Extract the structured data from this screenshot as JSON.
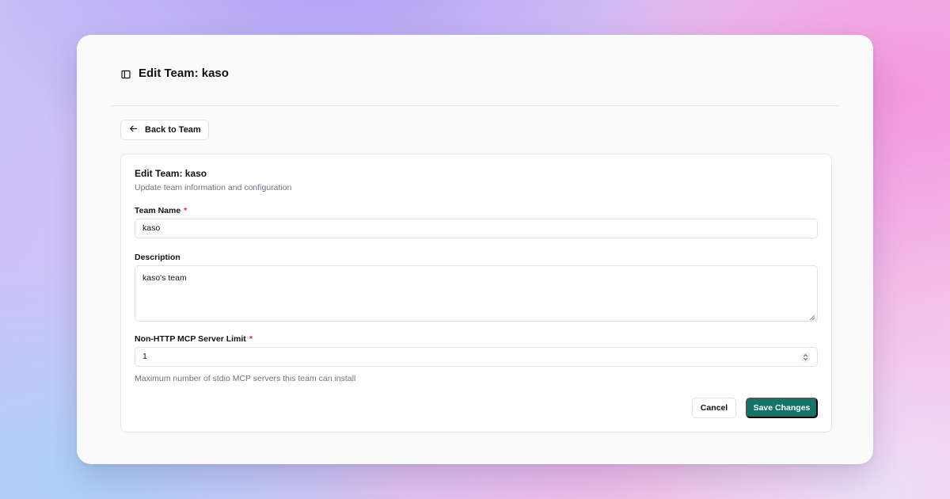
{
  "header": {
    "title": "Edit Team: kaso",
    "toggle_icon": "sidebar-toggle-icon"
  },
  "back_button": {
    "label": "Back to Team",
    "icon": "arrow-left-icon"
  },
  "card": {
    "title": "Edit Team: kaso",
    "subtitle": "Update team information and configuration"
  },
  "form": {
    "team_name": {
      "label": "Team Name",
      "required_mark": "*",
      "value": "kaso"
    },
    "description": {
      "label": "Description",
      "value": "kaso's team"
    },
    "server_limit": {
      "label": "Non-HTTP MCP Server Limit",
      "required_mark": "*",
      "value": "1",
      "helper": "Maximum number of stdio MCP servers this team can install"
    }
  },
  "actions": {
    "cancel_label": "Cancel",
    "save_label": "Save Changes"
  },
  "colors": {
    "primary": "#147468",
    "required": "#dc2626",
    "muted_text": "#6b7280"
  }
}
